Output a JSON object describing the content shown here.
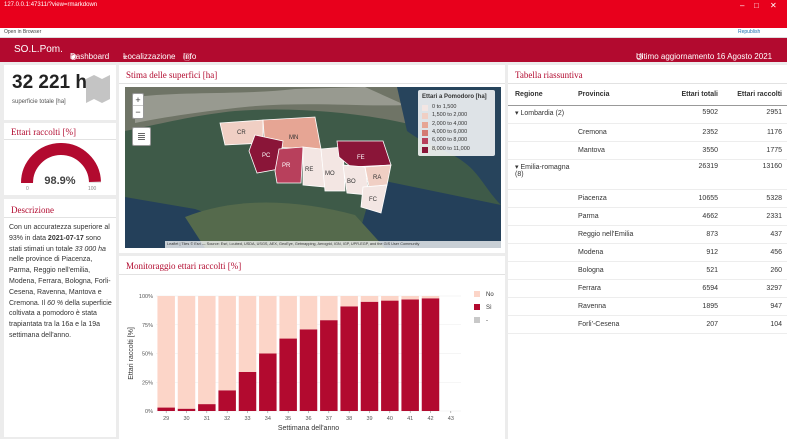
{
  "browser": {
    "url": "127.0.0.1:47311/?view=rmarkdown",
    "open_in_browser": "Open in Browser",
    "publish": "Republish"
  },
  "nav": {
    "brand": "SO.L.Pom.",
    "dashboard": "Dashboard",
    "localizzazione": "Localizzazione",
    "info": "Info",
    "updated": "Ultimo aggiornamento 16 Agosto 2021"
  },
  "summary": {
    "value": "32 221 ha",
    "label": "superficie totale [ha]"
  },
  "gauge": {
    "title": "Ettari raccolti [%]",
    "value": "98.9%",
    "min": "0",
    "max": "100",
    "fraction": 0.989
  },
  "description": {
    "title": "Descrizione",
    "p1": "Con un accuratezza superiore al 93% in data ",
    "date": "2021-07-17",
    "p2": " sono stati stimati un totale ",
    "total": "33 000 ha",
    "p3": " nelle province di Piacenza, Parma, Reggio nell'emilia, Modena, Ferrara, Bologna, Forli-Cesena, Ravenna, Mantova e Cremona. Il ",
    "pct": "60 %",
    "p4": " della superficie coltivata a pomodoro è stata trapiantata tra la 16a e la 19a settimana dell'anno."
  },
  "map": {
    "title": "Stima delle superfici [ha]",
    "zoom_in": "+",
    "zoom_out": "−",
    "legend_title": "Ettari a Pomodoro [ha]",
    "legend": [
      {
        "label": "0 to 1,500",
        "color": "#f3e6e3"
      },
      {
        "label": "1,500 to 2,000",
        "color": "#f0cfc4"
      },
      {
        "label": "2,000 to 4,000",
        "color": "#e6a594"
      },
      {
        "label": "4,000 to 6,000",
        "color": "#d47a73"
      },
      {
        "label": "6,000 to 8,000",
        "color": "#b8405c"
      },
      {
        "label": "8,000 to 11,000",
        "color": "#8a1538"
      }
    ],
    "regions": [
      "CR",
      "MN",
      "PC",
      "PR",
      "RE",
      "MO",
      "FE",
      "BO",
      "RA",
      "FC"
    ],
    "attribution": "Leaflet | Tiles © Esri — Source: Esri, i-cubed, USDA, USGS, AEX, GeoEye, Getmapping, Aerogrid, IGN, IGP, UPR-EGP, and the GIS User Community"
  },
  "chart": {
    "title": "Monitoraggio ettari raccolti [%]"
  },
  "chart_data": {
    "type": "bar",
    "stacked": true,
    "xlabel": "Settimana dell'anno",
    "ylabel": "Ettari raccolti [%]",
    "categories": [
      "29",
      "30",
      "31",
      "32",
      "33",
      "34",
      "35",
      "36",
      "37",
      "38",
      "39",
      "40",
      "41",
      "42",
      "43"
    ],
    "series": [
      {
        "name": "No",
        "color": "#fcd5c8",
        "values": [
          97,
          98,
          94,
          82,
          66,
          50,
          37,
          29,
          21,
          9,
          5,
          4,
          3,
          2,
          null
        ]
      },
      {
        "name": "Sì",
        "color": "#b20a2f",
        "values": [
          3,
          2,
          6,
          18,
          34,
          50,
          63,
          71,
          79,
          91,
          95,
          96,
          97,
          98,
          null
        ]
      },
      {
        "name": "-",
        "color": "#c8c8c8",
        "values": [
          0,
          0,
          0,
          0,
          0,
          0,
          0,
          0,
          0,
          0,
          0,
          0,
          0,
          0,
          null
        ]
      }
    ],
    "yticks": [
      "0%",
      "25%",
      "50%",
      "75%",
      "100%"
    ],
    "ylim": [
      0,
      100
    ]
  },
  "table": {
    "title": "Tabella riassuntiva",
    "headers": [
      "Regione",
      "Provincia",
      "Ettari totali",
      "Ettari raccolti"
    ],
    "rows": [
      {
        "regione": "Lombardia (2)",
        "provincia": "",
        "tot": "5902",
        "racc": "2951",
        "group": true
      },
      {
        "regione": "",
        "provincia": "Cremona",
        "tot": "2352",
        "racc": "1176"
      },
      {
        "regione": "",
        "provincia": "Mantova",
        "tot": "3550",
        "racc": "1775"
      },
      {
        "regione": "Emilia-romagna (8)",
        "provincia": "",
        "tot": "26319",
        "racc": "13160",
        "group": true
      },
      {
        "regione": "",
        "provincia": "Piacenza",
        "tot": "10655",
        "racc": "5328"
      },
      {
        "regione": "",
        "provincia": "Parma",
        "tot": "4662",
        "racc": "2331"
      },
      {
        "regione": "",
        "provincia": "Reggio nell'Emilia",
        "tot": "873",
        "racc": "437"
      },
      {
        "regione": "",
        "provincia": "Modena",
        "tot": "912",
        "racc": "456"
      },
      {
        "regione": "",
        "provincia": "Bologna",
        "tot": "521",
        "racc": "260"
      },
      {
        "regione": "",
        "provincia": "Ferrara",
        "tot": "6594",
        "racc": "3297"
      },
      {
        "regione": "",
        "provincia": "Ravenna",
        "tot": "1895",
        "racc": "947"
      },
      {
        "regione": "",
        "provincia": "Forli'-Cesena",
        "tot": "207",
        "racc": "104"
      }
    ]
  }
}
